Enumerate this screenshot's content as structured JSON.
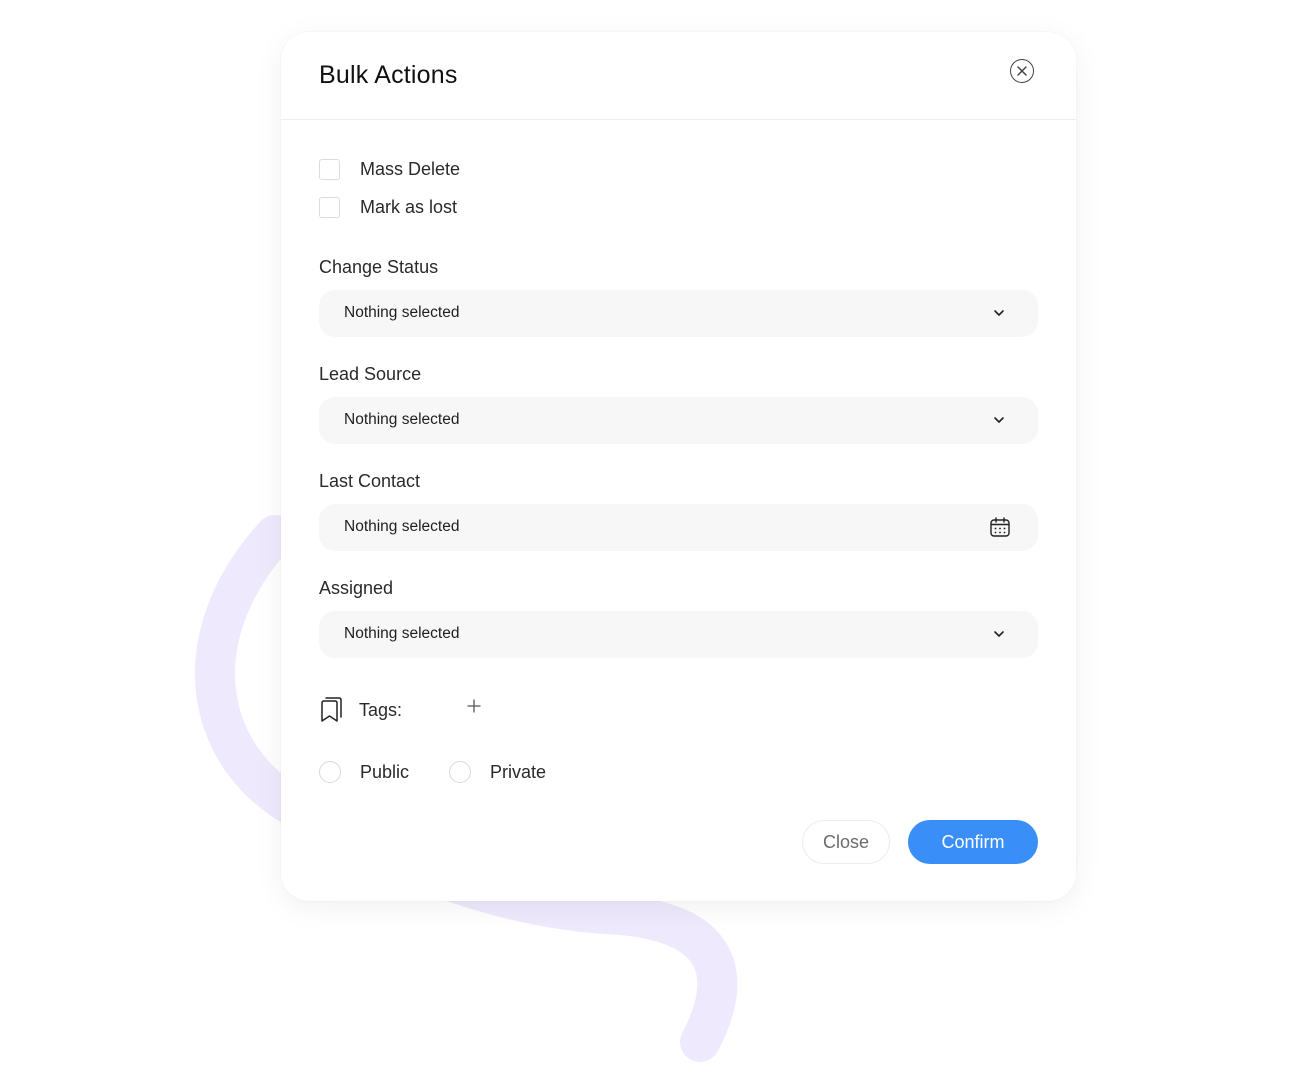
{
  "modal": {
    "title": "Bulk Actions"
  },
  "checkboxes": [
    {
      "label": "Mass Delete",
      "checked": false
    },
    {
      "label": "Mark as lost",
      "checked": false
    }
  ],
  "fields": [
    {
      "label": "Change Status",
      "value": "Nothing selected",
      "icon": "chevron-down-icon"
    },
    {
      "label": "Lead Source",
      "value": "Nothing selected",
      "icon": "chevron-down-icon"
    },
    {
      "label": "Last Contact",
      "value": "Nothing selected",
      "icon": "calendar-icon"
    },
    {
      "label": "Assigned",
      "value": "Nothing selected",
      "icon": "chevron-down-icon"
    }
  ],
  "tags": {
    "label": "Tags:",
    "icon": "bookmark-icon",
    "add_icon": "plus-icon"
  },
  "visibility": {
    "options": [
      {
        "label": "Public",
        "selected": false
      },
      {
        "label": "Private",
        "selected": false
      }
    ]
  },
  "footer": {
    "close_label": "Close",
    "confirm_label": "Confirm"
  },
  "colors": {
    "accent": "#3a8ef7",
    "decoration": "#efe9fd",
    "input_bg": "#f7f7f7"
  }
}
